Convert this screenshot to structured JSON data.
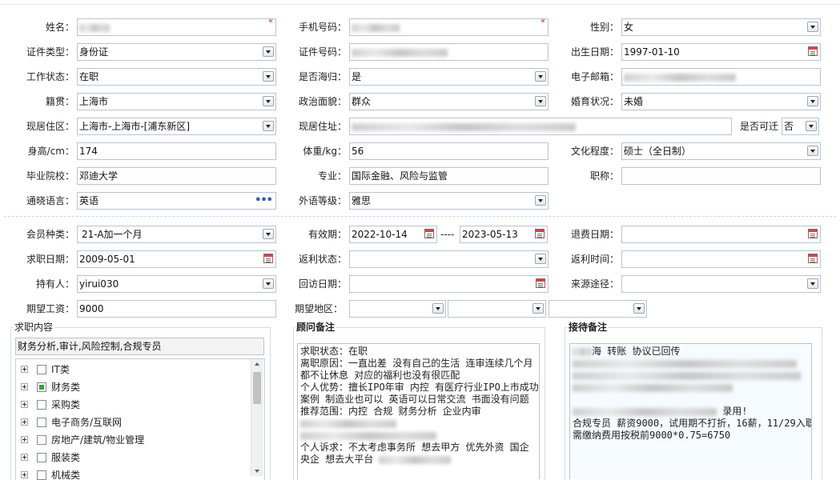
{
  "labels": {
    "name": "姓名：",
    "mobile": "手机号码：",
    "gender": "性别：",
    "id_type": "证件类型：",
    "id_no": "证件号码：",
    "birth_date": "出生日期：",
    "work_status": "工作状态：",
    "overseas_return": "是否海归：",
    "email": "电子邮箱：",
    "native_place": "籍贯：",
    "political_status": "政治面貌：",
    "marital_status": "婚育状况：",
    "residence_area": "现居住区：",
    "residence_address": "现居住址：",
    "relocate": "是否可迁",
    "height": "身高/cm：",
    "weight": "体重/kg：",
    "education": "文化程度：",
    "school": "毕业院校：",
    "major": "专业：",
    "title": "职称：",
    "language": "通晓语言：",
    "language_level": "外语等级：",
    "member_type": "会员种类：",
    "valid_period": "有效期：",
    "refund_date": "退费日期：",
    "job_seek_date": "求职日期：",
    "rebate_status": "返利状态：",
    "rebate_time": "返利时间：",
    "holder": "持有人：",
    "visit_date": "回访日期：",
    "source": "来源途径：",
    "expected_salary": "期望工资：",
    "expected_region": "期望地区："
  },
  "values": {
    "gender": "女",
    "id_type": "身份证",
    "birth_date": "1997-01-10",
    "work_status": "在职",
    "overseas_return": "是",
    "native_place": "上海市",
    "political_status": "群众",
    "marital_status": "未婚",
    "residence_area": "上海市-上海市-[浦东新区]",
    "relocate": "否",
    "height": "174",
    "weight": "56",
    "education": "硕士（全日制）",
    "school": "邓迪大学",
    "major": "国际金融、风险与监管",
    "title": "",
    "language": "英语",
    "language_level": "雅思",
    "member_type": "21-A加一个月",
    "valid_from": "2022-10-14",
    "valid_dash": "----",
    "valid_to": "2023-05-13",
    "refund_date": "",
    "job_seek_date": "2009-05-01",
    "rebate_status": "",
    "rebate_time": "",
    "holder": "yirui030",
    "visit_date": "",
    "source": "",
    "expected_salary": "9000"
  },
  "job_content": {
    "title": "求职内容",
    "selected": "财务分析,审计,风险控制,合规专员",
    "tree": [
      {
        "label": "IT类",
        "checked": false
      },
      {
        "label": "财务类",
        "checked": true
      },
      {
        "label": "采购类",
        "checked": false
      },
      {
        "label": "电子商务/互联网",
        "checked": false
      },
      {
        "label": "房地产/建筑/物业管理",
        "checked": false
      },
      {
        "label": "服装类",
        "checked": false
      },
      {
        "label": "机械类",
        "checked": false
      }
    ]
  },
  "consultant_notes": {
    "title": "顾问备注",
    "lines": [
      "求职状态：在职",
      "离职原因：一直出差 没有自己的生活 连审连续几个月",
      "都不让休息  对应的福利也没有很匹配",
      "个人优势：擅长IPO年审 内控  有医疗行业IPO上市成功",
      "案例 制造业也可以  英语可以日常交流 书面没有问题",
      "推荐范围：内控 合规 财务分析 企业内审",
      "",
      "",
      "个人诉求：不太考虑事务所 想去甲方  优先外资 国企",
      "央企 想去大平台"
    ]
  },
  "reception_notes": {
    "title": "接待备注",
    "line1_suffix": "海 转账 协议已回传",
    "hired": "录用!",
    "line_salary": "合规专员 薪资9000，试用期不打折，16薪，11/29入职",
    "line_fee": "需缴纳费用按税前9000*0.75=6750"
  },
  "colors": {
    "border": "#b9c4d1",
    "required": "#e03030",
    "checked": "#3aa23a",
    "more_dots": "#2a5fb0"
  }
}
